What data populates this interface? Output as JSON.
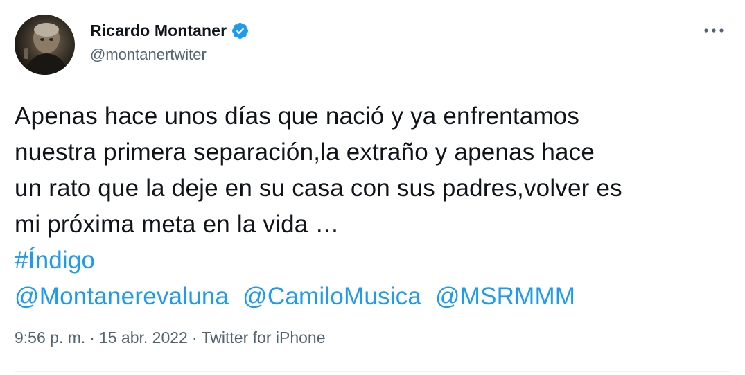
{
  "author": {
    "display_name": "Ricardo Montaner",
    "handle": "@montanertwiter",
    "verified": true
  },
  "tweet": {
    "text_lines": [
      "Apenas hace unos días que nació y ya enfrentamos",
      "nuestra primera separación,la extraño y apenas hace",
      "un rato que la deje en su casa con sus padres,volver es",
      "mi próxima meta en la vida …"
    ],
    "hashtag": "#Índigo",
    "mentions": [
      "@Montanerevaluna",
      "@CamiloMusica",
      "@MSRMMM"
    ]
  },
  "meta": {
    "time": "9:56 p. m.",
    "separator": "·",
    "date": "15 abr. 2022",
    "source": "Twitter for iPhone"
  },
  "icons": {
    "verified": "verified-badge-icon",
    "more": "more-options-icon"
  },
  "colors": {
    "link": "#1d9bf0",
    "text": "#0f1419",
    "secondary": "#536471",
    "verified": "#1d9bf0"
  }
}
